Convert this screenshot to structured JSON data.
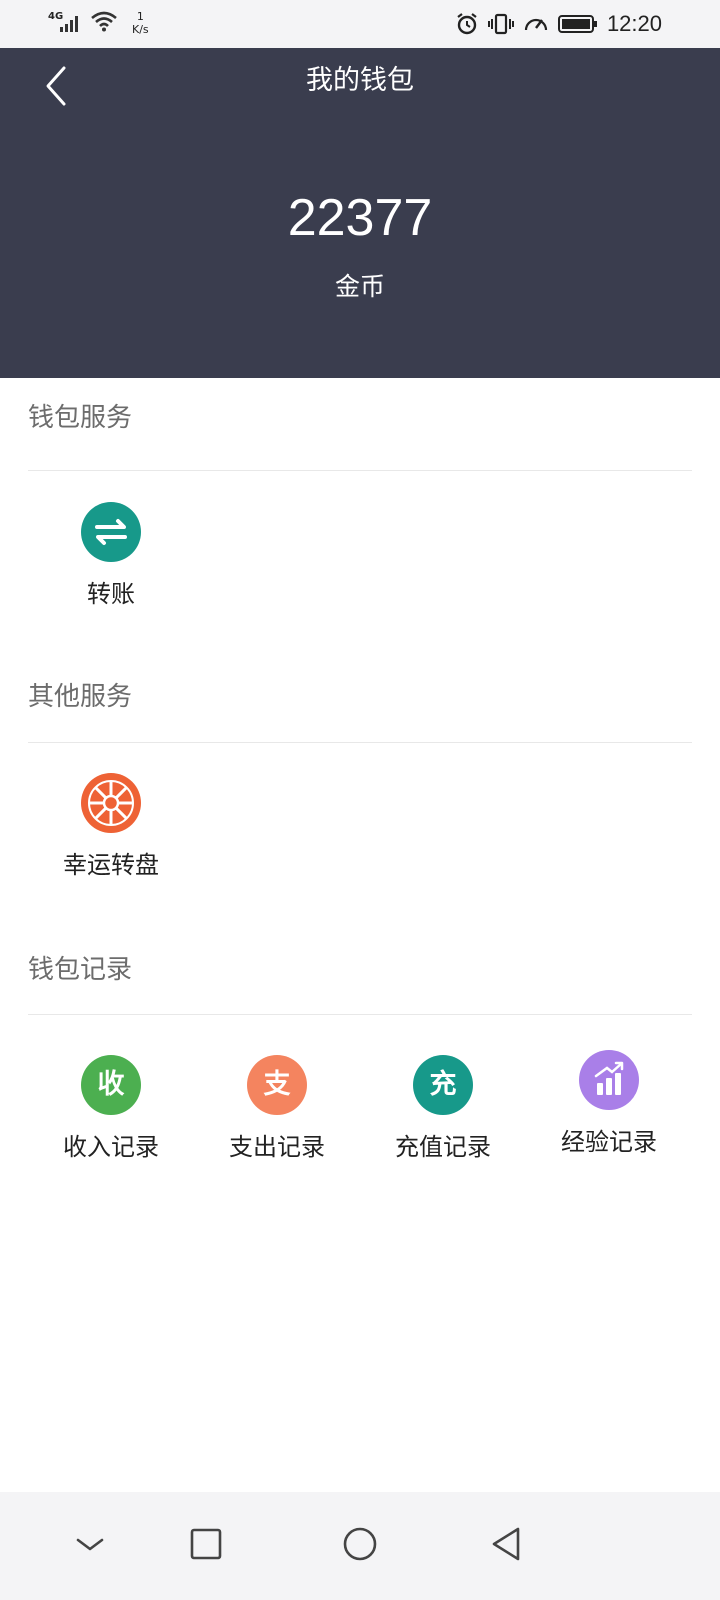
{
  "status_bar": {
    "network": "4G",
    "speed_value": "1",
    "speed_unit": "K/s",
    "time": "12:20"
  },
  "header": {
    "title": "我的钱包",
    "balance": "22377",
    "currency": "金币",
    "background": "#3a3d4e"
  },
  "sections": {
    "wallet_service": {
      "title": "钱包服务",
      "items": [
        {
          "label": "转账",
          "icon": "transfer-icon",
          "color": "#17998a"
        }
      ]
    },
    "other_service": {
      "title": "其他服务",
      "items": [
        {
          "label": "幸运转盘",
          "icon": "wheel-icon",
          "color": "#ee6235"
        }
      ]
    },
    "wallet_records": {
      "title": "钱包记录",
      "items": [
        {
          "label": "收入记录",
          "icon_text": "收",
          "icon": "income-icon",
          "color": "#4caf50"
        },
        {
          "label": "支出记录",
          "icon_text": "支",
          "icon": "expense-icon",
          "color": "#f4845f"
        },
        {
          "label": "充值记录",
          "icon_text": "充",
          "icon": "recharge-icon",
          "color": "#17998a"
        },
        {
          "label": "经验记录",
          "icon": "chart-icon",
          "color": "#a97fe8"
        }
      ]
    }
  },
  "nav": [
    "chevron-down-icon",
    "square-icon",
    "circle-home-icon",
    "triangle-back-icon"
  ]
}
